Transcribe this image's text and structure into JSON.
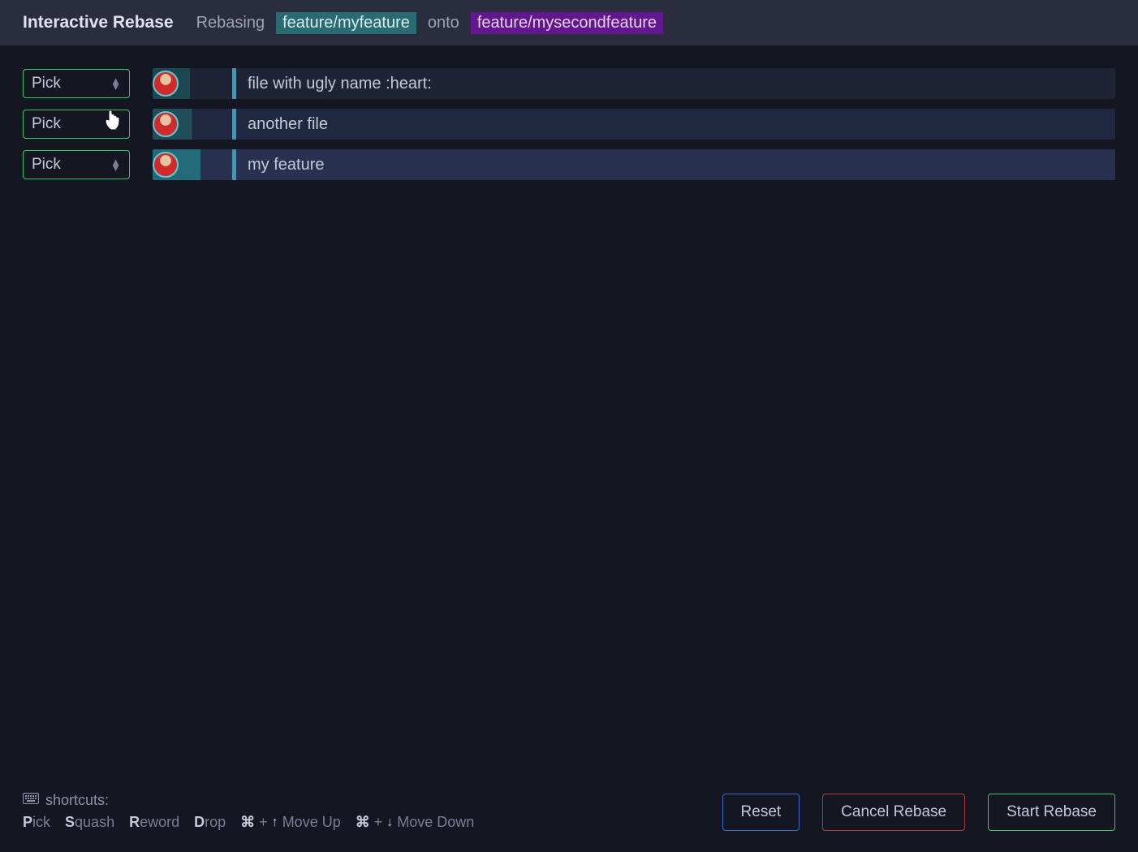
{
  "header": {
    "title": "Interactive Rebase",
    "status_label": "Rebasing",
    "src_branch": "feature/myfeature",
    "onto_label": "onto",
    "dst_branch": "feature/mysecondfeature"
  },
  "commits": [
    {
      "action": "Pick",
      "message": "file with ugly name :heart:"
    },
    {
      "action": "Pick",
      "message": "another file"
    },
    {
      "action": "Pick",
      "message": "my feature"
    }
  ],
  "shortcuts": {
    "label": "shortcuts:",
    "items": {
      "pick_key": "P",
      "pick_rest": "ick",
      "squash_key": "S",
      "squash_rest": "quash",
      "reword_key": "R",
      "reword_rest": "eword",
      "drop_key": "D",
      "drop_rest": "rop",
      "cmd": "⌘",
      "plus": "+",
      "move_up": "Move Up",
      "move_down": "Move Down"
    }
  },
  "buttons": {
    "reset": "Reset",
    "cancel": "Cancel Rebase",
    "start": "Start Rebase"
  }
}
